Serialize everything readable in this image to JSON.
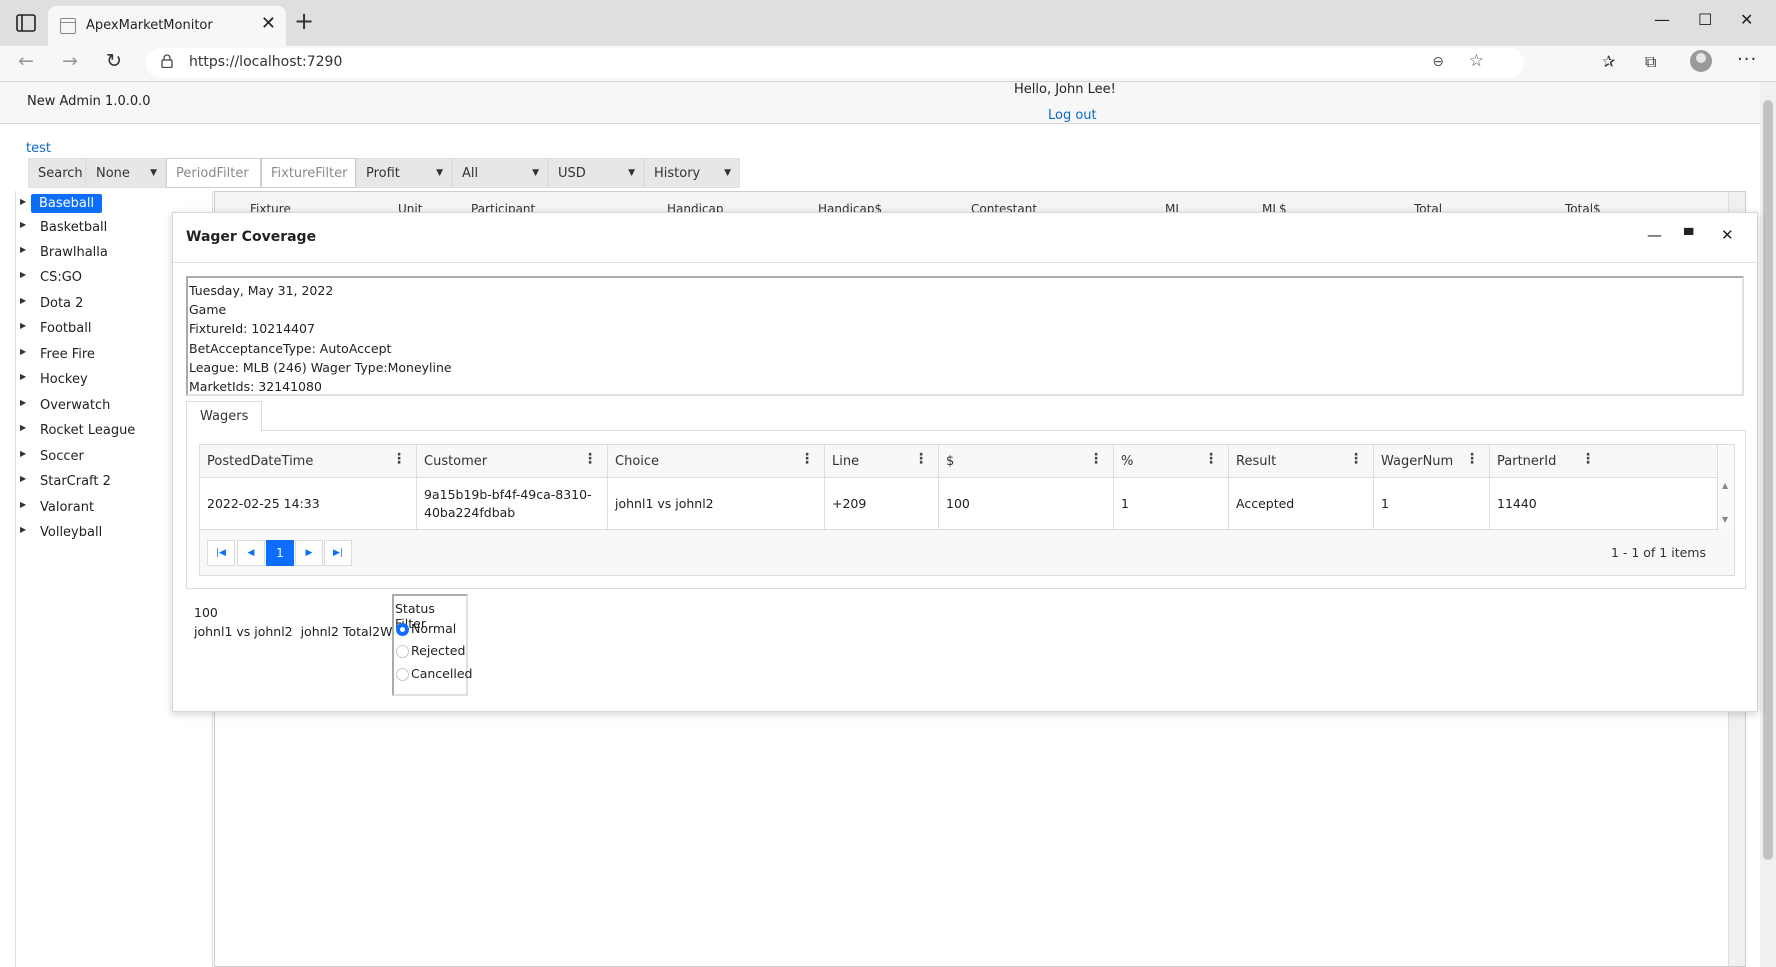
{
  "browser": {
    "tab_title": "ApexMarketMonitor",
    "url": "https://localhost:7290"
  },
  "header": {
    "version": "New Admin 1.0.0.0",
    "greeting": "Hello, John Lee!",
    "logout": "Log out"
  },
  "test_link": "test",
  "toolbar": {
    "search": "Search",
    "none": "None",
    "period_placeholder": "PeriodFilter",
    "fixture_placeholder": "FixtureFilter",
    "profit": "Profit",
    "all": "All",
    "currency": "USD",
    "history": "History"
  },
  "sidebar": {
    "items": [
      "Baseball",
      "Basketball",
      "Brawlhalla",
      "CS:GO",
      "Dota 2",
      "Football",
      "Free Fire",
      "Hockey",
      "Overwatch",
      "Rocket League",
      "Soccer",
      "StarCraft 2",
      "Valorant",
      "Volleyball"
    ],
    "selected": "Baseball"
  },
  "bg_grid": {
    "columns": [
      "Fixture",
      "Unit",
      "Participant",
      "Handicap",
      "Handicap$",
      "Contestant",
      "ML",
      "ML$",
      "Total",
      "Total$"
    ]
  },
  "modal": {
    "title": "Wager Coverage",
    "info_lines": [
      "Tuesday, May 31, 2022",
      "Game",
      "FixtureId: 10214407",
      "BetAcceptanceType: AutoAccept",
      "League: MLB (246) Wager Type:Moneyline",
      "MarketIds: 32141080"
    ],
    "tab": "Wagers",
    "columns": [
      "PostedDateTime",
      "Customer",
      "Choice",
      "Line",
      "$",
      "%",
      "Result",
      "WagerNum",
      "PartnerId"
    ],
    "rows": [
      {
        "posted": "2022-02-25 14:33",
        "customer": "9a15b19b-bf4f-49ca-8310-40ba224fdbab",
        "choice": "johnl1 vs johnl2",
        "line": "+209",
        "amount": "100",
        "percent": "1",
        "result": "Accepted",
        "wagernum": "1",
        "partnerid": "11440"
      }
    ],
    "pager": {
      "current_page": "1",
      "info": "1 - 1 of 1 items"
    },
    "summary": {
      "amount": "100",
      "desc": "johnl1 vs johnl2  johnl2 Total2Way"
    },
    "status_filter": {
      "title": "Status Filter",
      "options": [
        "Normal",
        "Rejected",
        "Cancelled"
      ],
      "selected": "Normal"
    }
  },
  "colors": {
    "accent": "#0d6efd",
    "link": "#0b67c7"
  }
}
